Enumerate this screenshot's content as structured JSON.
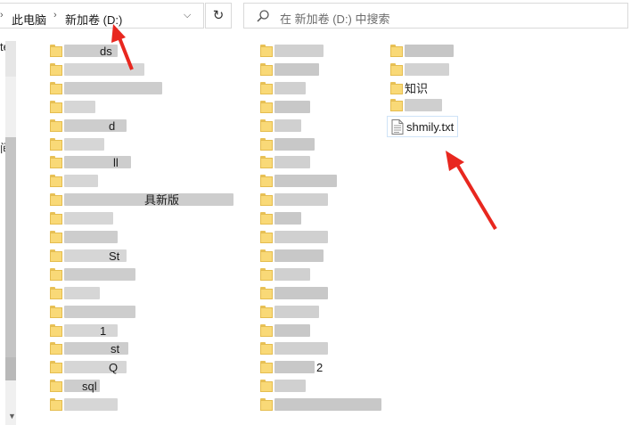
{
  "address_bar": {
    "partial_left_glyph": "›",
    "crumbs": [
      "此电脑",
      "新加卷 (D:)"
    ],
    "separator": "›",
    "dropdown_glyph": "⌵",
    "refresh_glyph": "↻"
  },
  "search": {
    "placeholder": "在 新加卷 (D:) 中搜索",
    "icon": "search-icon"
  },
  "nav_pane": {
    "partial_text_top": "ter",
    "partial_text_mid": "间"
  },
  "file_list": {
    "column1": [
      {
        "label": "ds",
        "visible": true
      },
      {
        "label": "",
        "visible": false
      },
      {
        "label": "",
        "visible": false
      },
      {
        "label": "",
        "visible": false
      },
      {
        "label": "d",
        "visible": true
      },
      {
        "label": "",
        "visible": false
      },
      {
        "label": "ll",
        "visible": true
      },
      {
        "label": "",
        "visible": false
      },
      {
        "label": "",
        "visible": false
      },
      {
        "label": "",
        "visible": false
      },
      {
        "label": "",
        "visible": false
      },
      {
        "label": "St",
        "visible": true
      },
      {
        "label": "",
        "visible": false
      },
      {
        "label": "",
        "visible": false
      },
      {
        "label": "",
        "visible": false
      },
      {
        "label": "1",
        "visible": true
      },
      {
        "label": "st",
        "visible": true
      },
      {
        "label": "Q",
        "visible": true
      },
      {
        "label": "sql",
        "visible": true
      },
      {
        "label": "",
        "visible": false
      }
    ],
    "column1_fragment_mid": "具新版",
    "column2_count": 20,
    "column2_fragment": "2",
    "column3_fragment": "知识",
    "file": {
      "name": "shmily.txt",
      "icon": "text-file-icon"
    }
  },
  "colors": {
    "folder": "#f9d977",
    "arrow": "#e8271f",
    "selection_border": "#cfe3f7"
  }
}
